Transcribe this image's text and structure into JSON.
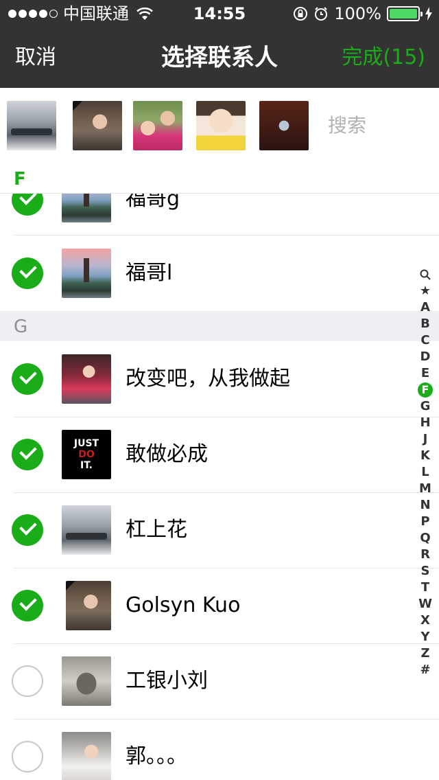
{
  "status_bar": {
    "carrier": "中国联通",
    "time": "14:55",
    "battery": "100%",
    "signal_icon": "signal-dots-icon",
    "wifi_icon": "wifi-icon"
  },
  "nav": {
    "cancel": "取消",
    "title": "选择联系人",
    "done": "完成(15)"
  },
  "selected": {
    "search_placeholder": "搜索"
  },
  "sections": {
    "f": "F",
    "g": "G"
  },
  "contacts": [
    {
      "name": "福哥g",
      "checked": true
    },
    {
      "name": "福哥l",
      "checked": true
    },
    {
      "name": "改变吧，从我做起",
      "checked": true
    },
    {
      "name": "敢做必成",
      "checked": true
    },
    {
      "name": "杠上花",
      "checked": true
    },
    {
      "name": "Golsyn Kuo",
      "checked": true
    },
    {
      "name": "工银小刘",
      "checked": false
    },
    {
      "name": "郭。。。",
      "checked": false
    }
  ],
  "nike_avatar": {
    "line1": "JUST",
    "line2": "DO",
    "line3": "IT."
  },
  "index": [
    "Q",
    "★",
    "A",
    "B",
    "C",
    "D",
    "E",
    "F",
    "G",
    "H",
    "J",
    "K",
    "L",
    "M",
    "N",
    "P",
    "Q",
    "R",
    "S",
    "T",
    "W",
    "X",
    "Y",
    "Z",
    "#"
  ],
  "colors": {
    "accent": "#1aad19",
    "nav_bg": "#333333",
    "section_bg": "#eeeef3"
  }
}
